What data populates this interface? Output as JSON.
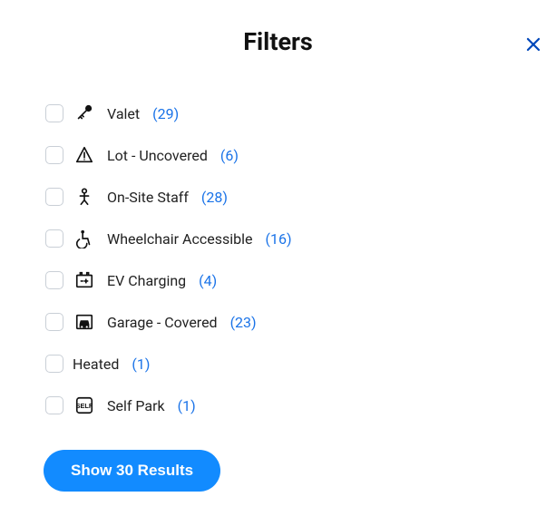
{
  "title": "Filters",
  "filters": [
    {
      "id": "valet",
      "label": "Valet",
      "count": "(29)",
      "icon": "key-icon"
    },
    {
      "id": "lot-uncovered",
      "label": "Lot - Uncovered",
      "count": "(6)",
      "icon": "warning-icon"
    },
    {
      "id": "on-site-staff",
      "label": "On-Site Staff",
      "count": "(28)",
      "icon": "person-icon"
    },
    {
      "id": "wheelchair",
      "label": "Wheelchair Accessible",
      "count": "(16)",
      "icon": "wheelchair-icon"
    },
    {
      "id": "ev-charging",
      "label": "EV Charging",
      "count": "(4)",
      "icon": "battery-icon"
    },
    {
      "id": "garage-covered",
      "label": "Garage - Covered",
      "count": "(23)",
      "icon": "garage-icon"
    },
    {
      "id": "heated",
      "label": "Heated",
      "count": "(1)",
      "icon": null
    },
    {
      "id": "self-park",
      "label": "Self Park",
      "count": "(1)",
      "icon": "self-icon"
    }
  ],
  "results_button": "Show 30 Results"
}
